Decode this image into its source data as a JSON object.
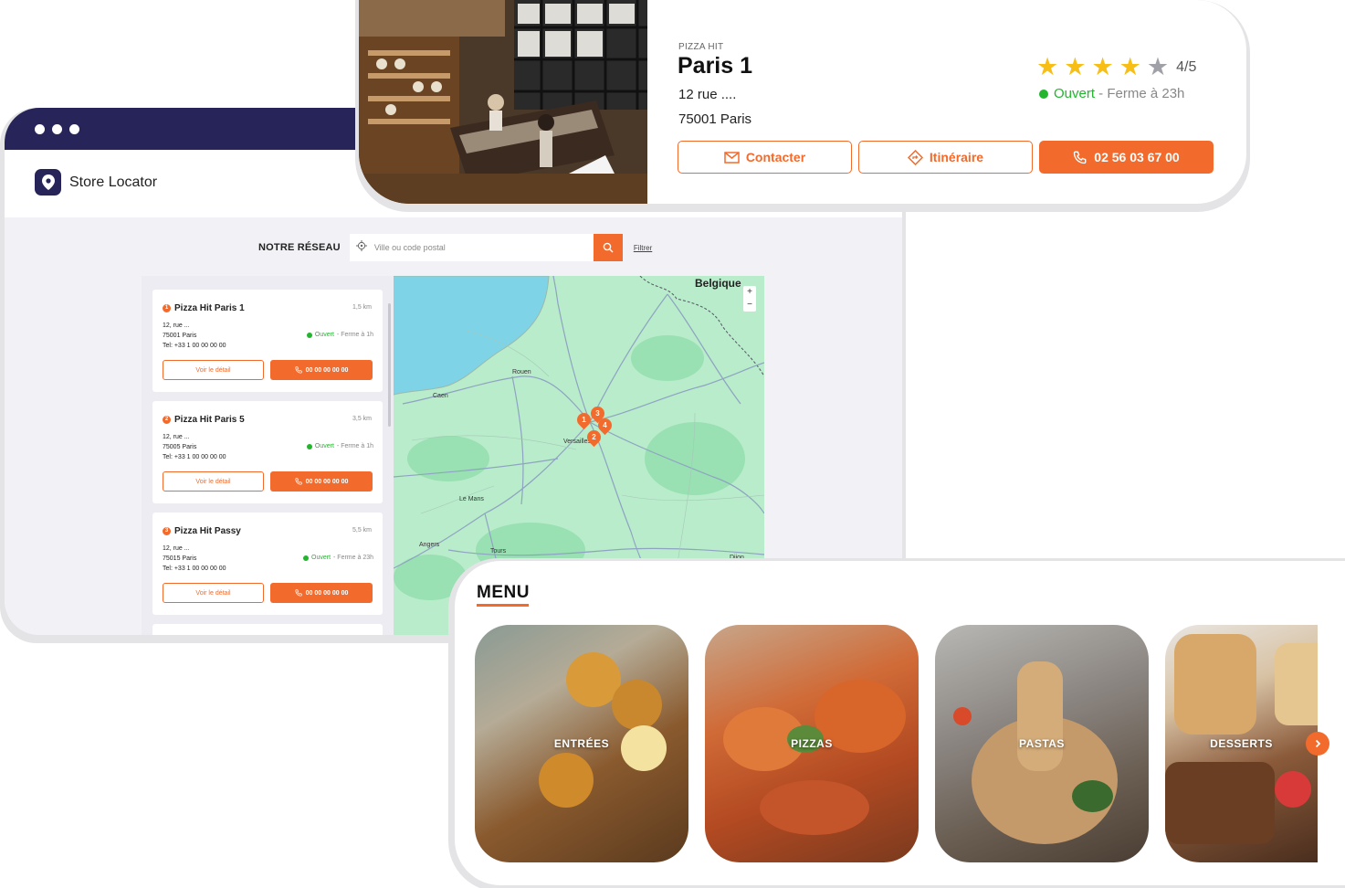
{
  "locator": {
    "app_title": "Store Locator",
    "network_label": "NOTRE RÉSEAU",
    "search_placeholder": "Ville ou code postal",
    "filter_label": "Filtrer",
    "stores": [
      {
        "marker": "1",
        "name": "Pizza Hit Paris 1",
        "distance": "1,5 km",
        "street": "12, rue ...",
        "city": "75001 Paris",
        "tel": "Tel: +33 1 00 00 00 00",
        "status_open": "Ouvert",
        "status_rest": " - Ferme à 1h",
        "detail_label": "Voir le détail",
        "phone_label": "00 00 00 00 00"
      },
      {
        "marker": "2",
        "name": "Pizza Hit Paris 5",
        "distance": "3,5 km",
        "street": "12, rue ...",
        "city": "75005 Paris",
        "tel": "Tel: +33 1 00 00 00 00",
        "status_open": "Ouvert",
        "status_rest": " - Ferme à 1h",
        "detail_label": "Voir le détail",
        "phone_label": "00 00 00 00 00"
      },
      {
        "marker": "3",
        "name": "Pizza Hit Passy",
        "distance": "5,5 km",
        "street": "12, rue ...",
        "city": "75015 Paris",
        "tel": "Tel: +33 1 00 00 00 00",
        "status_open": "Ouvert",
        "status_rest": " - Ferme à 23h",
        "detail_label": "Voir le détail",
        "phone_label": "00 00 00 00 00"
      }
    ],
    "map": {
      "country_label": "Belgique",
      "cities": [
        "Rouen",
        "Caen",
        "Versailles",
        "Le Mans",
        "Angers",
        "Tours",
        "Dijon"
      ],
      "clusters": [
        "1",
        "3",
        "4",
        "2"
      ],
      "zoom_in": "+",
      "zoom_out": "−"
    }
  },
  "detail": {
    "brand": "PIZZA HIT",
    "name": "Paris 1",
    "address_line1": "12 rue ....",
    "address_line2": "75001 Paris",
    "rating": 4,
    "rating_max": 5,
    "rating_text": "4/5",
    "status_open": "Ouvert",
    "status_rest": " - Ferme à 23h",
    "contact_label": "Contacter",
    "route_label": "Itinéraire",
    "phone_label": "02 56 03 67 00"
  },
  "menu": {
    "title": "MENU",
    "categories": [
      {
        "label": "ENTRÉES"
      },
      {
        "label": "PIZZAS"
      },
      {
        "label": "PASTAS"
      },
      {
        "label": "DESSERTS"
      }
    ]
  },
  "colors": {
    "accent": "#f26b2c",
    "navy": "#27245a",
    "open_green": "#22b52d",
    "star": "#f7be16"
  }
}
